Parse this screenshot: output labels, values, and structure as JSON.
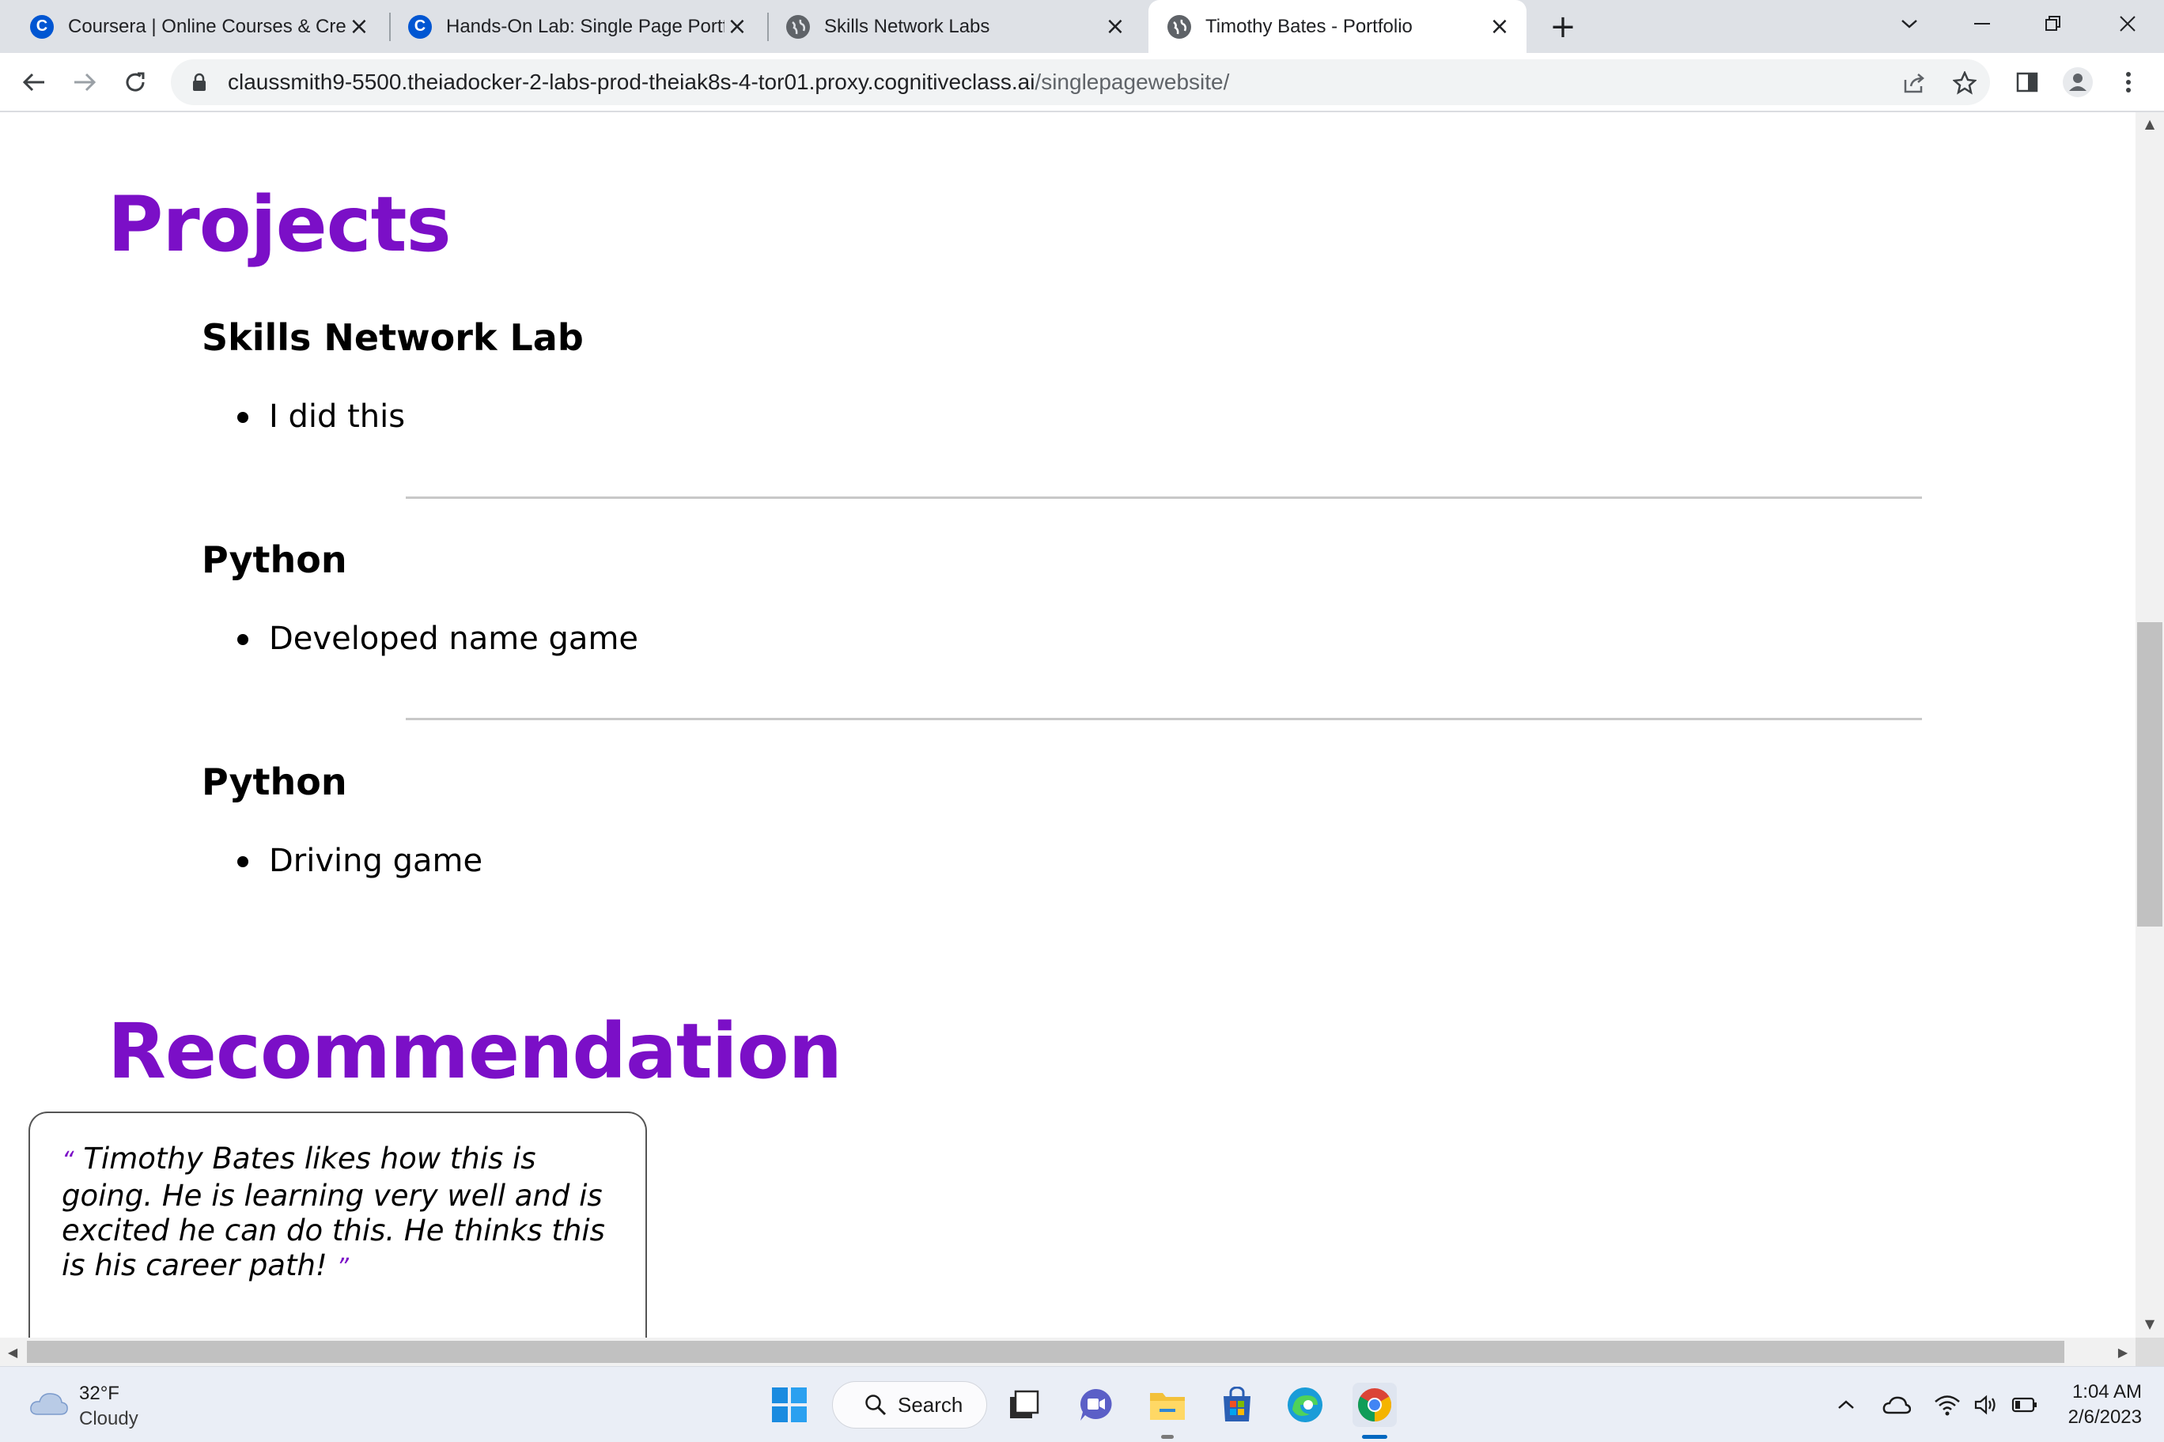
{
  "browser": {
    "tabs": [
      {
        "title": "Coursera | Online Courses & Credentials",
        "favicon": "coursera-icon",
        "active": false
      },
      {
        "title": "Hands-On Lab: Single Page Portfolio",
        "favicon": "coursera-icon",
        "active": false
      },
      {
        "title": "Skills Network Labs",
        "favicon": "globe-icon",
        "active": false
      },
      {
        "title": "Timothy Bates - Portfolio",
        "favicon": "globe-icon",
        "active": true
      }
    ],
    "new_tab": "+",
    "url_host": "claussmith9-5500.theiadocker-2-labs-prod-theiak8s-4-tor01.proxy.cognitiveclass.ai",
    "url_path": "/singlepagewebsite/"
  },
  "page": {
    "projects_heading": "Projects",
    "projects": [
      {
        "title": "Skills Network Lab",
        "item": "I did this"
      },
      {
        "title": "Python",
        "item": "Developed name game"
      },
      {
        "title": "Python",
        "item": "Driving game"
      }
    ],
    "recommendation_heading": "Recommendation",
    "recommendation": {
      "open_quote": "“",
      "text": "Timothy Bates likes how this is going. He is learning very well and is excited he can do this. He thinks this is his career path!",
      "close_quote": "”"
    },
    "accent_color": "#7b0fc7"
  },
  "taskbar": {
    "weather_temp": "32°F",
    "weather_desc": "Cloudy",
    "search_label": "Search",
    "time": "1:04 AM",
    "date": "2/6/2023"
  }
}
